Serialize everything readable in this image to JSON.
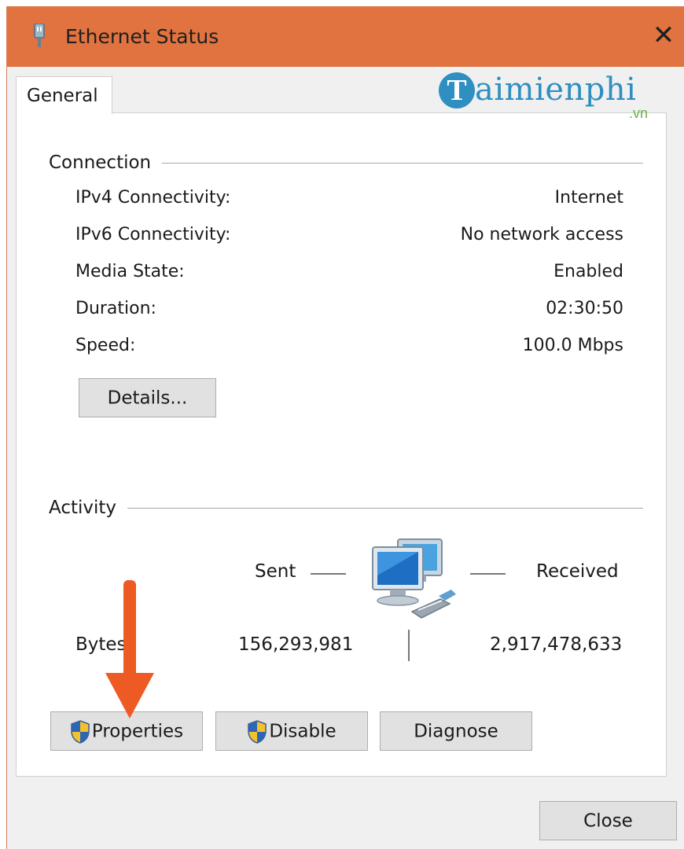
{
  "window": {
    "title": "Ethernet Status",
    "title_icon": "ethernet-adapter-icon",
    "close_glyph": "✕",
    "accent_color": "#e0733f"
  },
  "tabs": [
    {
      "label": "General",
      "selected": true
    }
  ],
  "watermark": {
    "brand": "aimienphi",
    "initial": "T",
    "suffix": ".vn"
  },
  "connection": {
    "heading": "Connection",
    "rows": [
      {
        "label": "IPv4 Connectivity:",
        "value": "Internet"
      },
      {
        "label": "IPv6 Connectivity:",
        "value": "No network access"
      },
      {
        "label": "Media State:",
        "value": "Enabled"
      },
      {
        "label": "Duration:",
        "value": "02:30:50"
      },
      {
        "label": "Speed:",
        "value": "100.0 Mbps"
      }
    ],
    "details_button": "Details..."
  },
  "activity": {
    "heading": "Activity",
    "sent_label": "Sent",
    "received_label": "Received",
    "bytes_label": "Bytes:",
    "bytes_sent": "156,293,981",
    "bytes_received": "2,917,478,633",
    "icon": "network-computers-icon"
  },
  "buttons": {
    "properties": "Properties",
    "disable": "Disable",
    "diagnose": "Diagnose",
    "close": "Close"
  },
  "annotation": {
    "icon": "red-down-arrow-icon",
    "color": "#ee5a24"
  }
}
